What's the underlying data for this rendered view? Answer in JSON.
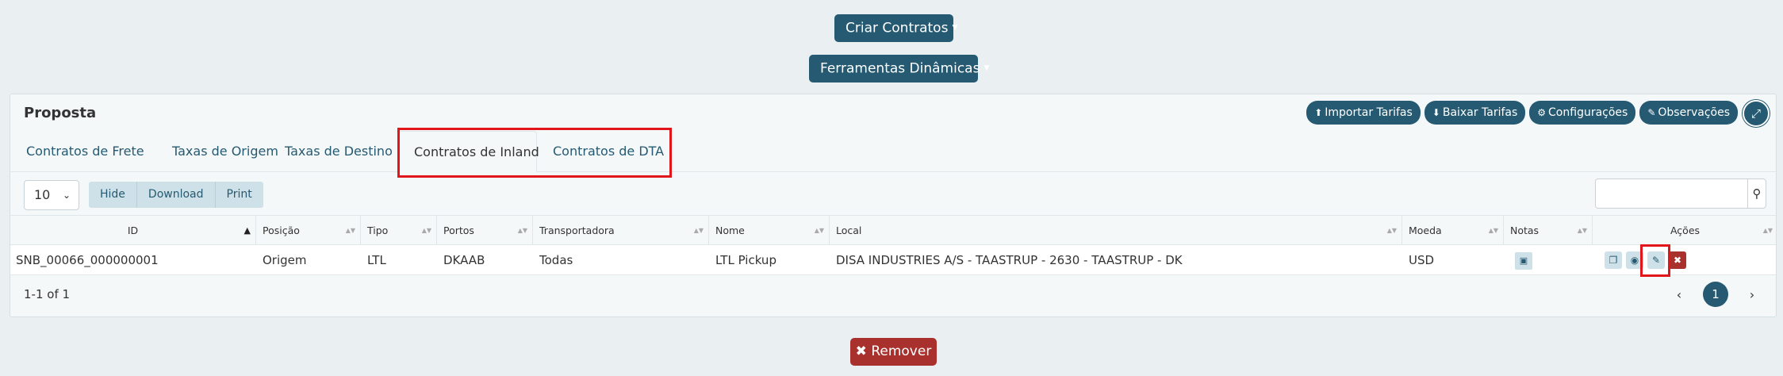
{
  "top_buttons": {
    "criar_contratos": "Criar Contratos",
    "ferramentas": "Ferramentas Dinâmicas"
  },
  "panel": {
    "title": "Proposta",
    "header_buttons": [
      {
        "label": "Importar Tarifas",
        "icon": "upload-icon"
      },
      {
        "label": "Baixar Tarifas",
        "icon": "download-icon"
      },
      {
        "label": "Configurações",
        "icon": "gear-icon"
      },
      {
        "label": "Observações",
        "icon": "pencil-icon"
      }
    ],
    "expand_icon": "expand-icon"
  },
  "tabs": [
    {
      "label": "Contratos de Frete"
    },
    {
      "label": "Taxas de Origem"
    },
    {
      "label": "Taxas de Destino"
    },
    {
      "label": "Contratos de Inland",
      "active": true
    },
    {
      "label": "Contratos de DTA"
    }
  ],
  "controls": {
    "page_length": "10",
    "buttons": [
      "Hide",
      "Download",
      "Print"
    ]
  },
  "table": {
    "columns": [
      "ID",
      "Posição",
      "Tipo",
      "Portos",
      "Transportadora",
      "Nome",
      "Local",
      "Moeda",
      "Notas",
      "Ações"
    ],
    "rows": [
      {
        "id": "SNB_00066_000000001",
        "posicao": "Origem",
        "tipo": "LTL",
        "portos": "DKAAB",
        "transportadora": "Todas",
        "nome": "LTL Pickup",
        "local": "DISA INDUSTRIES A/S - TAASTRUP - 2630 - TAASTRUP - DK",
        "moeda": "USD"
      }
    ]
  },
  "footer": {
    "info": "1-1 of 1",
    "current_page": "1"
  },
  "remove_button": "Remover",
  "colors": {
    "primary": "#255a72",
    "danger": "#a8312d",
    "highlight": "#e0161b",
    "background": "#eaf0f2"
  }
}
